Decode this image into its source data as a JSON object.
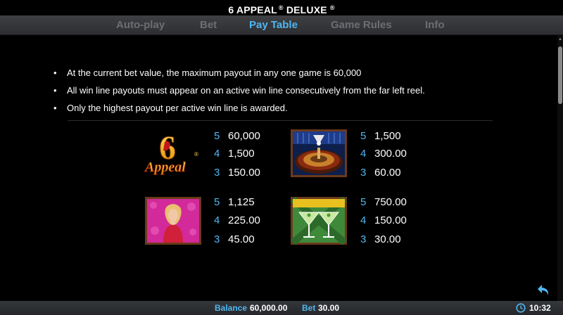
{
  "header": {
    "title": "6 APPEAL",
    "registered": "®",
    "title_rest": " DELUXE",
    "superscript": "®"
  },
  "tabs": [
    {
      "label": "Auto-play",
      "active": false
    },
    {
      "label": "Bet",
      "active": false
    },
    {
      "label": "Pay Table",
      "active": true
    },
    {
      "label": "Game Rules",
      "active": false
    },
    {
      "label": "Info",
      "active": false
    }
  ],
  "rules": [
    "At the current bet value, the maximum payout in any one game is 60,000",
    "All win line payouts must appear on an active win line consecutively from the far left reel.",
    "Only the highest payout per active win line is awarded."
  ],
  "paytable": [
    {
      "symbol_icon": "six-appeal-logo-icon",
      "logo_text": "Appeal",
      "logo_digit": "6",
      "logo_reg": "®",
      "payouts": [
        {
          "count": "5",
          "amount": "60,000"
        },
        {
          "count": "4",
          "amount": "1,500"
        },
        {
          "count": "3",
          "amount": "150.00"
        }
      ]
    },
    {
      "symbol_icon": "roulette-wheel-icon",
      "payouts": [
        {
          "count": "5",
          "amount": "1,500"
        },
        {
          "count": "4",
          "amount": "300.00"
        },
        {
          "count": "3",
          "amount": "60.00"
        }
      ]
    },
    {
      "symbol_icon": "woman-in-red-icon",
      "payouts": [
        {
          "count": "5",
          "amount": "1,125"
        },
        {
          "count": "4",
          "amount": "225.00"
        },
        {
          "count": "3",
          "amount": "45.00"
        }
      ]
    },
    {
      "symbol_icon": "martini-glasses-icon",
      "payouts": [
        {
          "count": "5",
          "amount": "750.00"
        },
        {
          "count": "4",
          "amount": "150.00"
        },
        {
          "count": "3",
          "amount": "30.00"
        }
      ]
    }
  ],
  "footer": {
    "balance_label": "Balance",
    "balance_value": "60,000.00",
    "bet_label": "Bet",
    "bet_value": "30.00",
    "clock": "10:32"
  },
  "colors": {
    "accent": "#4fb6f0",
    "background": "#000000",
    "tabbar": "#34373b",
    "inactive_tab": "#6b6e72"
  }
}
